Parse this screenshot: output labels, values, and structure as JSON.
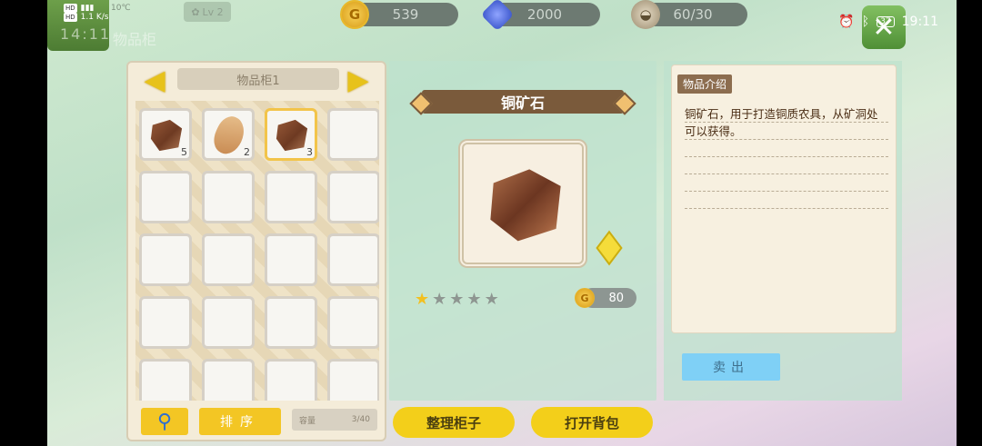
{
  "status_bar": {
    "time": "19:11",
    "battery": "37",
    "network": "1.1 K/s",
    "left_time_ghost": "14:11"
  },
  "top_bar": {
    "ghost_title": "物品柜",
    "weather_temp": "10℃",
    "level": "Lv 2",
    "coins": "539",
    "gems": "2000",
    "stamina": "60/30",
    "close_icon": "close-icon"
  },
  "cabinet": {
    "title": "物品柜1",
    "slots": [
      {
        "item": "copper-ore",
        "qty": "5"
      },
      {
        "item": "stone",
        "qty": "2"
      },
      {
        "item": "copper-ore",
        "qty": "3",
        "selected": true
      }
    ],
    "sort_label": "排序",
    "capacity_label": "容量",
    "capacity_value": "3/40"
  },
  "detail": {
    "name": "铜矿石",
    "stars_filled": 1,
    "stars_total": 5,
    "price": "80",
    "organize_label": "整理柜子",
    "open_bag_label": "打开背包"
  },
  "info": {
    "header": "物品介绍",
    "description": "铜矿石，用于打造铜质农具，从矿洞处可以获得。",
    "sell_label": "卖出"
  },
  "colors": {
    "accent_yellow": "#f3cf1a",
    "banner_brown": "#7a5a3b",
    "sell_blue": "#7fd0f6"
  }
}
